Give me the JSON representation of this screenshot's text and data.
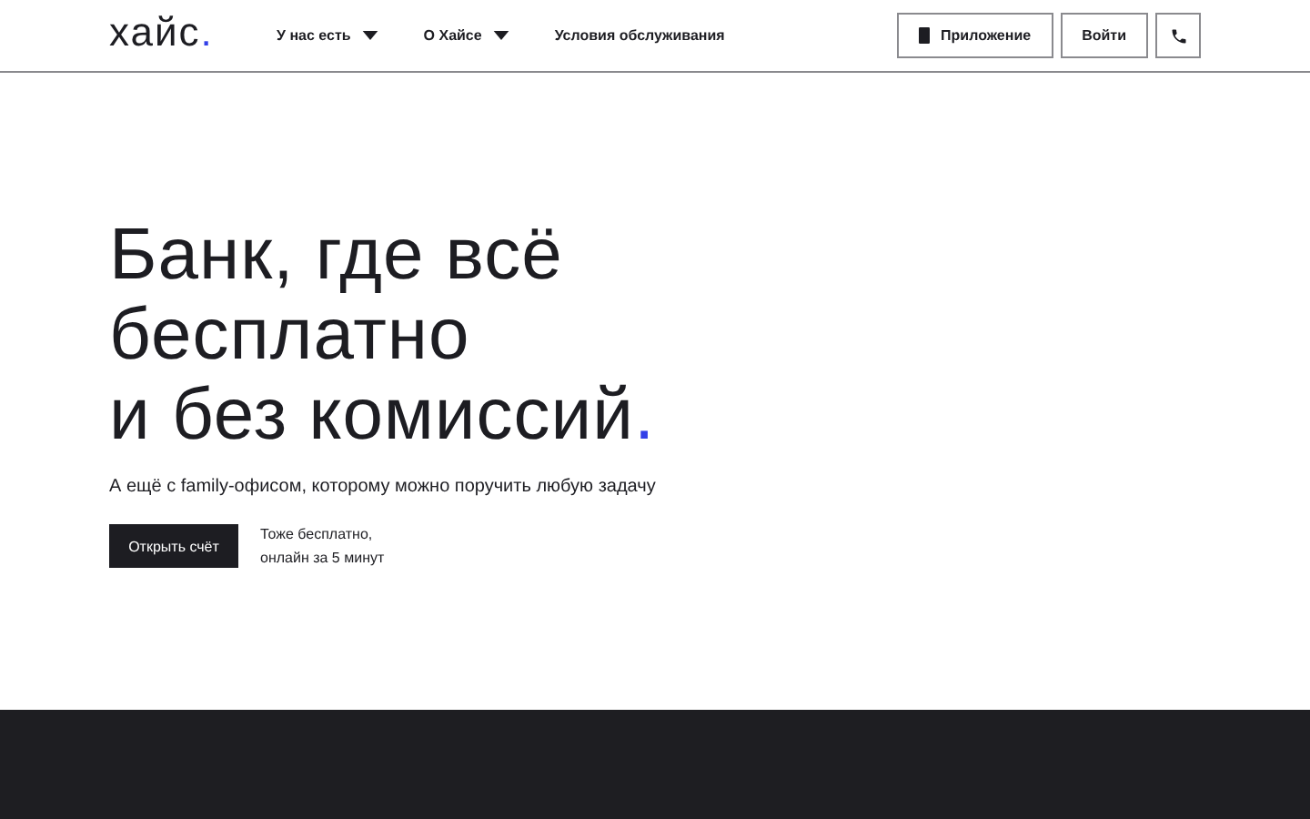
{
  "header": {
    "logo": {
      "text": "хайс",
      "accent": "."
    },
    "nav": [
      {
        "label": "У нас есть",
        "dropdown": true
      },
      {
        "label": "О Хайсе",
        "dropdown": true
      },
      {
        "label": "Условия обслуживания",
        "dropdown": false
      }
    ],
    "actions": [
      {
        "kind": "app",
        "label": "Приложение"
      },
      {
        "kind": "login",
        "label": "Войти"
      },
      {
        "kind": "phone"
      }
    ]
  },
  "hero": {
    "headline_lines": [
      "Банк, где всё",
      "бесплатно",
      "и без комиссий"
    ],
    "headline_accent": ".",
    "subtitle": "А ещё с family-офисом, которому можно поручить любую задачу",
    "cta": "Открыть счёт",
    "cta_note_lines": [
      "Тоже бесплатно,",
      "онлайн за 5 минут"
    ]
  }
}
